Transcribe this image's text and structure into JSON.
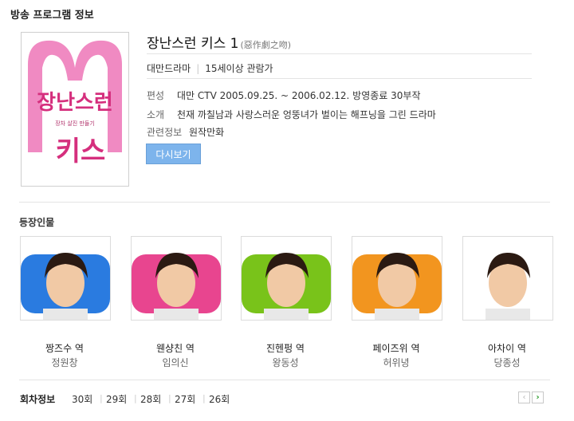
{
  "section_title": "방송 프로그램 정보",
  "program": {
    "title": "장난스런 키스 1",
    "original_title": "(惡作劇之吻)",
    "poster_text_main": "장난스런",
    "poster_text_sub": "키스",
    "poster_tagline": "장차 살진 만들기"
  },
  "meta": {
    "genre": "대만드라마",
    "rating": "15세이상 관람가"
  },
  "details": {
    "schedule_label": "편성",
    "schedule_value": "대만 CTV 2005.09.25. ~ 2006.02.12. 방영종료 30부작",
    "summary_label": "소개",
    "summary_value": "천재 까칠남과 사랑스러운 엉뚱녀가 벌이는 해프닝을 그린 드라마",
    "related_label": "관련정보",
    "related_value": "원작만화"
  },
  "rewatch_button": "다시보기",
  "cast_section_title": "등장인물",
  "cast": [
    {
      "role": "짱즈수 역",
      "actor": "정원창",
      "bg": "#2a7be0"
    },
    {
      "role": "웬샹친 역",
      "actor": "임의신",
      "bg": "#e8458f"
    },
    {
      "role": "진헨펑 역",
      "actor": "왕동성",
      "bg": "#79c31a"
    },
    {
      "role": "페이즈위 역",
      "actor": "허위녕",
      "bg": "#f2951f"
    },
    {
      "role": "아차이 역",
      "actor": "당종성",
      "bg": "#ffffff"
    }
  ],
  "episodes": {
    "label": "회차정보",
    "items": [
      "30회",
      "29회",
      "28회",
      "27회",
      "26회"
    ],
    "prev": "‹",
    "next": "›"
  }
}
